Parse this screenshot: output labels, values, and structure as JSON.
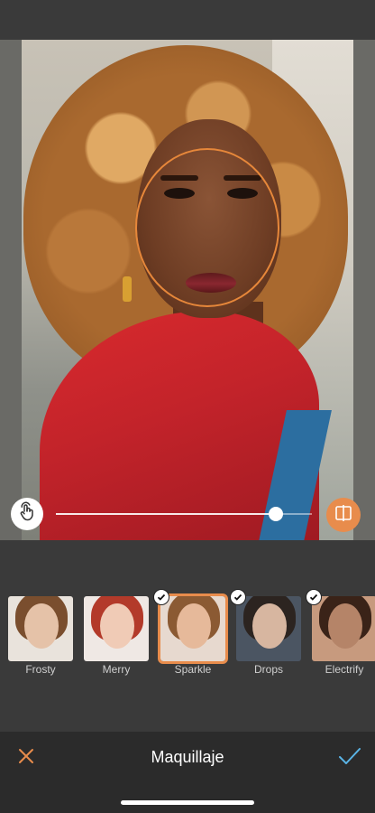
{
  "editor": {
    "title": "Maquillaje",
    "intensity": 0.86
  },
  "filters": [
    {
      "label": "Frosty",
      "checked": false,
      "selected": false
    },
    {
      "label": "Merry",
      "checked": false,
      "selected": false
    },
    {
      "label": "Sparkle",
      "checked": true,
      "selected": true
    },
    {
      "label": "Drops",
      "checked": true,
      "selected": false
    },
    {
      "label": "Electrify",
      "checked": true,
      "selected": false
    }
  ],
  "colors": {
    "accent": "#e88c4c",
    "confirm": "#5ab4e6",
    "background": "#3a3a3a",
    "bottom_bar": "#2b2b2b"
  },
  "icons": {
    "touch": "hand-touch-icon",
    "compare": "compare-split-icon",
    "close": "close-icon",
    "confirm": "checkmark-icon",
    "filter_check": "check-badge-icon"
  }
}
